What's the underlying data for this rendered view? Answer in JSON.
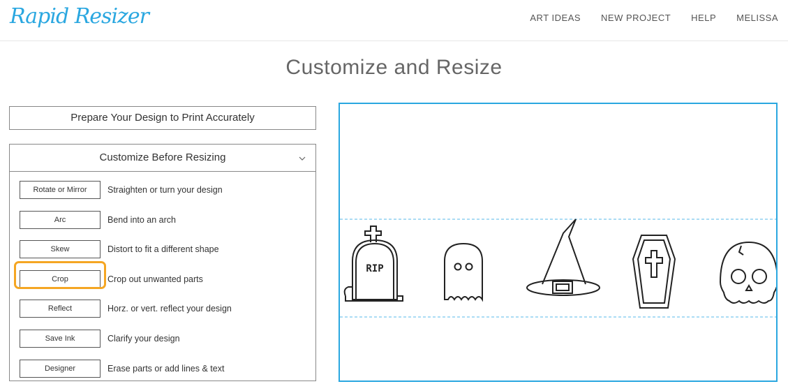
{
  "app": {
    "logo": "Rapid Resizer"
  },
  "nav": {
    "items": [
      "ART IDEAS",
      "NEW PROJECT",
      "HELP",
      "MELISSA"
    ]
  },
  "page": {
    "title": "Customize and Resize"
  },
  "panels": {
    "prepare_label": "Prepare Your Design to Print Accurately",
    "customize_label": "Customize Before Resizing",
    "chevron_icon": "chevron-down-icon"
  },
  "tools": [
    {
      "label": "Rotate or Mirror",
      "desc": "Straighten or turn your design"
    },
    {
      "label": "Arc",
      "desc": "Bend into an arch"
    },
    {
      "label": "Skew",
      "desc": "Distort to fit a different shape"
    },
    {
      "label": "Crop",
      "desc": "Crop out unwanted parts"
    },
    {
      "label": "Reflect",
      "desc": "Horz. or vert. reflect your design"
    },
    {
      "label": "Save Ink",
      "desc": "Clarify your design"
    },
    {
      "label": "Designer",
      "desc": "Erase parts or add lines & text"
    }
  ],
  "canvas": {
    "tombstone_text": "RIP"
  },
  "colors": {
    "accent": "#2aa7e0",
    "highlight": "#f5a623",
    "dashed_guide": "#8fd0f0"
  }
}
